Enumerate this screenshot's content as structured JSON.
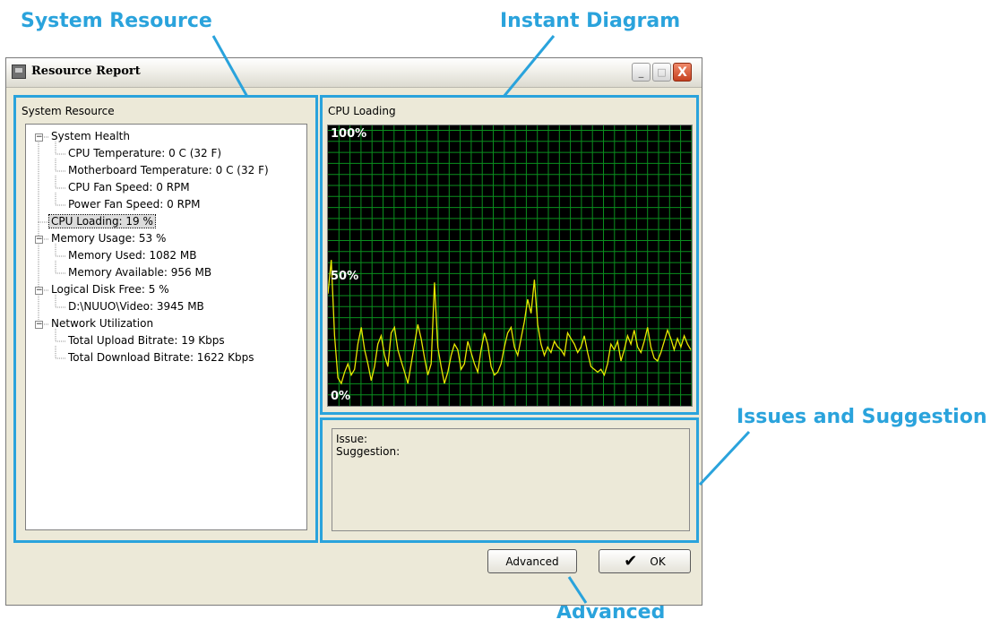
{
  "callouts": {
    "system_resource": "System Resource",
    "instant_diagram": "Instant Diagram",
    "issues": "Issues and Suggestion",
    "advanced": "Advanced"
  },
  "window": {
    "title": "Resource Report",
    "controls": {
      "minimize": "_",
      "maximize": "□",
      "close": "X"
    }
  },
  "left_panel": {
    "title": "System Resource",
    "tree": [
      {
        "text": "System Health",
        "level": 0,
        "expander": "−"
      },
      {
        "text": "CPU Temperature: 0 C (32 F)",
        "level": 1
      },
      {
        "text": "Motherboard Temperature: 0 C (32 F)",
        "level": 1
      },
      {
        "text": "CPU Fan Speed: 0 RPM",
        "level": 1
      },
      {
        "text": "Power Fan Speed: 0 RPM",
        "level": 1
      },
      {
        "text": "CPU Loading: 19 %",
        "level": 0,
        "selected": true
      },
      {
        "text": "Memory Usage: 53 %",
        "level": 0,
        "expander": "−"
      },
      {
        "text": "Memory Used: 1082 MB",
        "level": 1
      },
      {
        "text": "Memory Available: 956 MB",
        "level": 1
      },
      {
        "text": "Logical Disk Free: 5 %",
        "level": 0,
        "expander": "−"
      },
      {
        "text": "D:\\NUUO\\Video: 3945 MB",
        "level": 1
      },
      {
        "text": "Network Utilization",
        "level": 0,
        "expander": "−"
      },
      {
        "text": "Total Upload Bitrate: 19 Kbps",
        "level": 1
      },
      {
        "text": "Total Download Bitrate: 1622 Kbps",
        "level": 1
      }
    ]
  },
  "cpu_panel": {
    "title": "CPU Loading",
    "labels": {
      "top": "100%",
      "mid": "50%",
      "bottom": "0%"
    },
    "colors": {
      "background": "#000000",
      "grid": "#0a8f1e",
      "line": "#e8e800"
    }
  },
  "chart_data": {
    "type": "line",
    "title": "CPU Loading",
    "ylim": [
      0,
      100
    ],
    "grid": true,
    "yticks": [
      "0%",
      "50%",
      "100%"
    ],
    "series": [
      {
        "values": [
          40,
          52,
          25,
          10,
          8,
          12,
          15,
          11,
          13,
          22,
          28,
          20,
          15,
          9,
          14,
          22,
          25,
          18,
          14,
          26,
          28,
          20,
          16,
          12,
          8,
          15,
          22,
          29,
          24,
          17,
          11,
          15,
          44,
          21,
          14,
          8,
          12,
          18,
          22,
          20,
          13,
          15,
          23,
          19,
          15,
          12,
          20,
          26,
          22,
          14,
          11,
          12,
          15,
          21,
          26,
          28,
          21,
          18,
          24,
          30,
          38,
          33,
          45,
          29,
          22,
          18,
          21,
          19,
          23,
          21,
          20,
          18,
          26,
          24,
          22,
          19,
          21,
          25,
          19,
          14,
          13,
          12,
          13,
          11,
          15,
          22,
          20,
          23,
          16,
          20,
          25,
          22,
          27,
          21,
          19,
          23,
          28,
          21,
          17,
          16,
          19,
          23,
          27,
          24,
          20,
          24,
          21,
          25,
          22,
          20
        ]
      }
    ]
  },
  "issue_panel": {
    "issue_label": "Issue:",
    "suggestion_label": "Suggestion:"
  },
  "buttons": {
    "advanced": "Advanced",
    "ok": "OK"
  },
  "accent_color": "#2aa3dc"
}
